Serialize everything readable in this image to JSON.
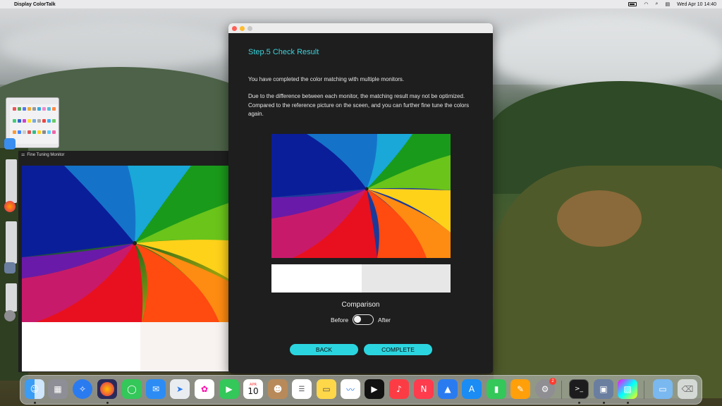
{
  "menubar": {
    "apple": "",
    "app_name": "Display ColorTalk",
    "datetime": "Wed Apr 10  14:40"
  },
  "fine_tuning": {
    "title": "Fine Tuning Monitor",
    "swatch_left": "#ffffff",
    "swatch_right": "#f8f3f0"
  },
  "dialog": {
    "step_title": "Step.5 Check Result",
    "paragraph1": "You have completed the color matching with multiple monitors.",
    "paragraph2": "Due to the difference between each monitor, the matching result may not be optimized. Compared to the reference picture on the sceen, and you can further fine tune the colors again.",
    "swatch_left": "#ffffff",
    "swatch_right": "#e7e7e7",
    "comparison_label": "Comparison",
    "before_label": "Before",
    "after_label": "After",
    "back_label": "BACK",
    "complete_label": "COMPLETE",
    "accent": "#2bd5df"
  },
  "dock": {
    "calendar_month": "APR",
    "calendar_day": "10",
    "settings_badge": "2",
    "apps": [
      "Finder",
      "Launchpad",
      "Safari",
      "Firefox",
      "Messages",
      "Mail",
      "Maps",
      "Photos",
      "FaceTime",
      "Calendar",
      "Contacts",
      "Reminders",
      "Notes",
      "Freeform",
      "TV",
      "Music",
      "News",
      "Keynote",
      "App Store",
      "Numbers",
      "Pages",
      "System Settings",
      "Terminal",
      "Display ColorTalk",
      "Color Profile",
      "Downloads",
      "Trash"
    ]
  }
}
